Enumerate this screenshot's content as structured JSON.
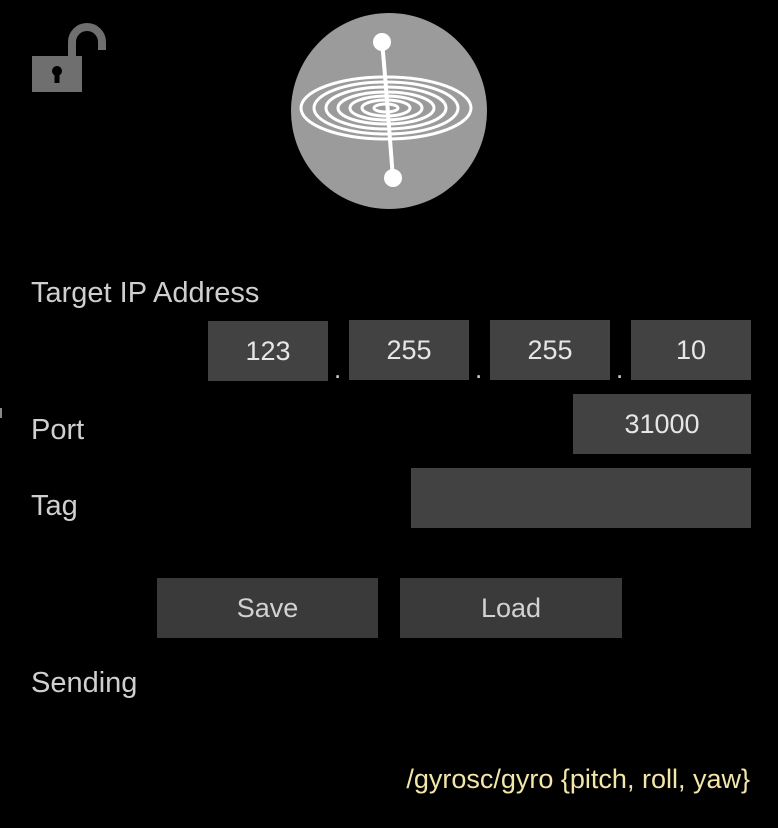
{
  "lock": {
    "icon": "unlocked-padlock-icon",
    "color": "#6f6f6f"
  },
  "logo": {
    "icon": "gyroscope-logo-icon",
    "color": "#9b9b9b"
  },
  "target_ip": {
    "label": "Target IP Address",
    "octets": [
      "123",
      "255",
      "255",
      "10"
    ],
    "separator": "."
  },
  "port": {
    "label": "Port",
    "value": "31000"
  },
  "tag": {
    "label": "Tag",
    "value": ""
  },
  "buttons": {
    "save": "Save",
    "load": "Load"
  },
  "status": {
    "label": "Sending"
  },
  "osc": {
    "path": "/gyrosc/gyro {pitch, roll, yaw}",
    "color": "#f2e6a8"
  },
  "colors": {
    "background": "#000000",
    "field": "#424242",
    "button": "#3a3a3a",
    "text": "#cfcfcf"
  }
}
